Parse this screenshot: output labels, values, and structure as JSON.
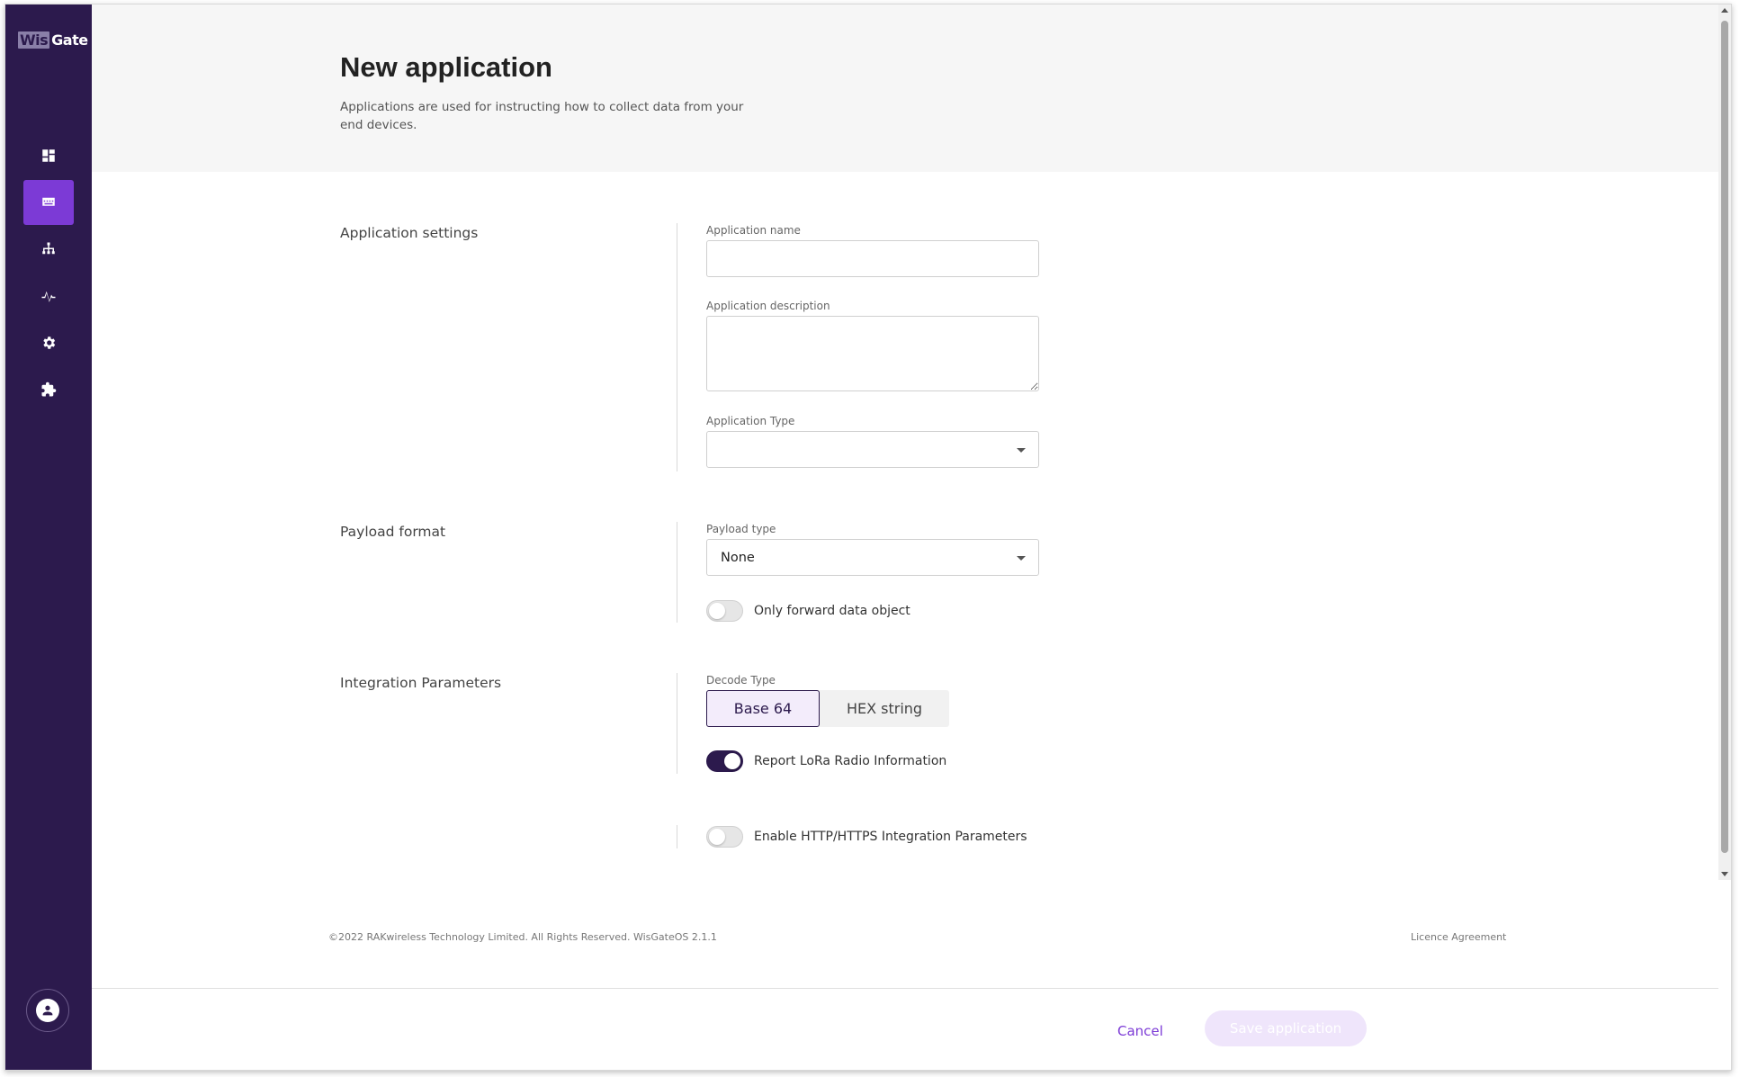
{
  "brand": {
    "logo_part1": "Wis",
    "logo_part2": "Gate"
  },
  "sidebar": {
    "items": [
      {
        "name": "dashboard",
        "icon": "dashboard-icon",
        "active": false
      },
      {
        "name": "applications",
        "icon": "applications-icon",
        "active": true
      },
      {
        "name": "network",
        "icon": "network-icon",
        "active": false
      },
      {
        "name": "activity",
        "icon": "activity-icon",
        "active": false
      },
      {
        "name": "settings",
        "icon": "gear-icon",
        "active": false
      },
      {
        "name": "extensions",
        "icon": "puzzle-icon",
        "active": false
      }
    ],
    "profile_icon": "user-icon"
  },
  "header": {
    "title": "New application",
    "subtitle": "Applications are used for instructing how to collect data from your end devices."
  },
  "sections": {
    "app_settings": {
      "label": "Application settings",
      "name_label": "Application name",
      "name_value": "",
      "description_label": "Application description",
      "description_value": "",
      "type_label": "Application Type",
      "type_value": ""
    },
    "payload": {
      "label": "Payload format",
      "type_label": "Payload type",
      "type_value": "None",
      "forward_label": "Only forward data object",
      "forward_on": false
    },
    "integration": {
      "label": "Integration Parameters",
      "decode_label": "Decode Type",
      "decode_options": [
        "Base 64",
        "HEX string"
      ],
      "decode_selected": "Base 64",
      "lora_label": "Report LoRa Radio Information",
      "lora_on": true,
      "http_label": "Enable HTTP/HTTPS Integration Parameters",
      "http_on": false
    }
  },
  "footer": {
    "copyright": "©2022 RAKwireless Technology Limited. All Rights Reserved. WisGateOS 2.1.1",
    "licence": "Licence Agreement"
  },
  "actions": {
    "cancel": "Cancel",
    "save": "Save application"
  },
  "colors": {
    "sidebar": "#2c1a4d",
    "accent": "#7c3ad6",
    "save_disabled": "#efe5fb"
  }
}
